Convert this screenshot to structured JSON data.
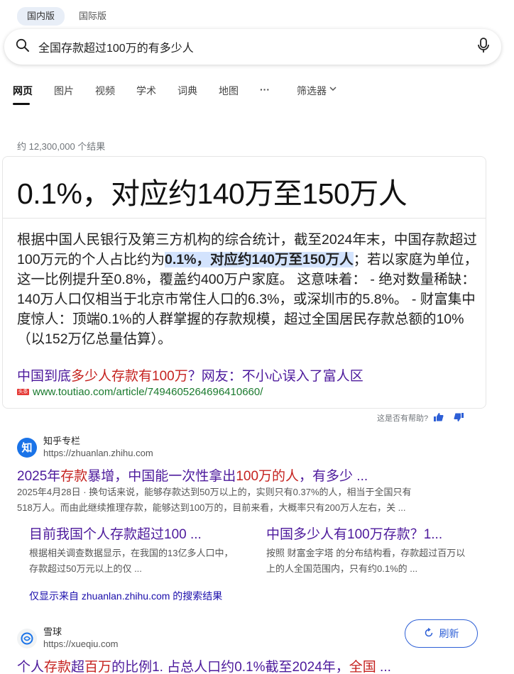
{
  "version_tabs": [
    {
      "label": "国内版"
    },
    {
      "label": "国际版"
    }
  ],
  "search": {
    "query": "全国存款超过100万的有多少人"
  },
  "nav": {
    "items": [
      {
        "label": "网页"
      },
      {
        "label": "图片"
      },
      {
        "label": "视频"
      },
      {
        "label": "学术"
      },
      {
        "label": "词典"
      },
      {
        "label": "地图"
      },
      {
        "label": "···"
      }
    ],
    "filter_label": "筛选器"
  },
  "results_count": "约 12,300,000 个结果",
  "answer": {
    "title": "0.1%，对应约140万至150万人",
    "body_before": "根据中国人民银行及第三方机构的综合统计，截至2024年末，中国存款超过100万元的个人占比约为",
    "body_highlight": "0.1%，对应约140万至150万人",
    "body_after": "；若以家庭为单位，这一比例提升至0.8%，覆盖约400万户家庭。 这意味着： - 绝对数量稀缺：140万人口仅相当于北京市常住人口的6.3%，或深圳市的5.8%。 - 财富集中度惊人：顶端0.1%的人群掌握的存款规模，超过全国居民存款总额的10%（以152万亿总量估算）。",
    "link_parts": [
      "中国到底",
      "多少人存款有100万",
      "？网友：不小心误入了富人区"
    ],
    "source_icon_text": "头条",
    "url": "www.toutiao.com/article/7494605264696410660/"
  },
  "feedback": {
    "label": "这是否有帮助?"
  },
  "result1": {
    "site_name": "知乎专栏",
    "favicon_text": "知",
    "url": "https://zhuanlan.zhihu.com",
    "title_parts": [
      "2025年",
      "存款",
      "暴增，中国能一次性拿出",
      "100万的人",
      "，有多少 ..."
    ],
    "date": "2025年4月28日",
    "snippet_line1": " · 换句话来说，能够存款达到50万以上的，实则只有0.37%的人，相当于全国只有",
    "snippet_line2": "518万人。而由此继续推理存款，能够达到100万的，目前来看，大概率只有200万人左右，关 ...",
    "subs": [
      {
        "title": "目前我国个人存款超过100 ...",
        "desc": "根据相关调查数据显示，在我国的13亿多人口中，存款超过50万元以上的仅 ..."
      },
      {
        "title": "中国多少人有100万存款？1...",
        "desc": "按照 财富金字塔 的分布结构看，存款超过百万以上的人全国范围内，只有约0.1%的 ..."
      }
    ],
    "only_from": "仅显示来自 zhuanlan.zhihu.com 的搜索结果"
  },
  "result2": {
    "site_name": "雪球",
    "url": "https://xueqiu.com",
    "title_parts": [
      "个人",
      "存款",
      "超",
      "百万",
      "的比例1. 占总人口约0.1%截至2024年，",
      "全国",
      " ..."
    ]
  },
  "refresh": {
    "label": "刷新"
  },
  "colors": {
    "accent": "#2d5fd6",
    "link_visited": "#4d1a9c",
    "highlight": "#c5221f",
    "url_green": "#1a7a2e"
  }
}
